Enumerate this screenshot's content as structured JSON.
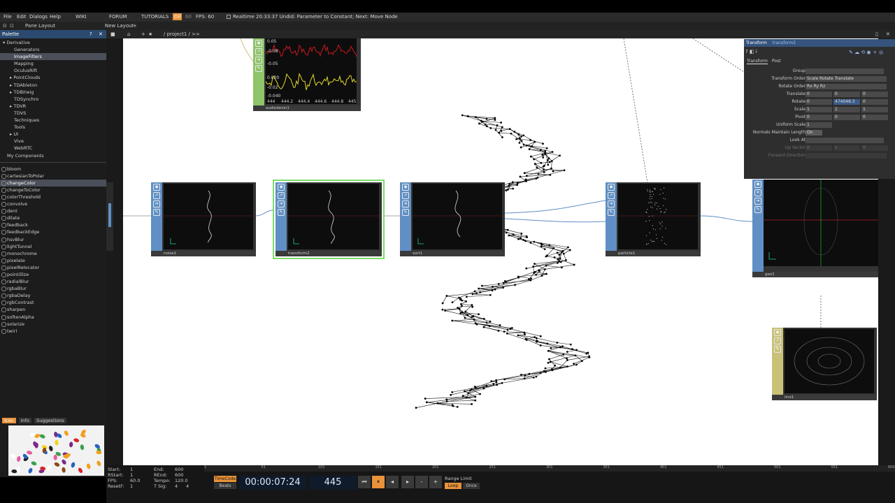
{
  "menubar": {
    "items": [
      "File",
      "Edit",
      "Dialogs",
      "Help",
      "WIKI",
      "FORUM",
      "TUTORIALS"
    ],
    "oil": "Oil",
    "fps_label": "60",
    "fps": "FPS:  60",
    "realtime": "Realtime",
    "status": "20:33:37 Undid: Parameter to Constant; Next: Move Node"
  },
  "toolbar": {
    "pane_layout": "Pane Layout",
    "new_layout": "New Layout"
  },
  "pathbar": {
    "path": "/ project1 / >>"
  },
  "palette": {
    "title": "Palette",
    "tree": [
      "Derivative",
      "Generators",
      "ImageFilters",
      "Mapping",
      "OculusRift",
      "PointClouds",
      "TDAbleton",
      "TDBitwig",
      "TDSynchro",
      "TDVR",
      "TDVS",
      "Techniques",
      "Tools",
      "UI",
      "Vive",
      "WebRTC",
      "My Components"
    ],
    "components": [
      "bloom",
      "cartesianToPolar",
      "changeColor",
      "changeToColor",
      "colorThreshold",
      "convolve",
      "dent",
      "dilate",
      "feedback",
      "feedbackEdge",
      "hsvBlur",
      "lightTunnel",
      "monochrome",
      "pixelate",
      "pixelRelocator",
      "pointillize",
      "radialBlur",
      "rgbaBlur",
      "rgbaDelay",
      "rgbContrast",
      "sharpen",
      "softenAlpha",
      "solarize",
      "twirl"
    ],
    "tabs": [
      "Icon",
      "Info",
      "Suggestions"
    ]
  },
  "nodes": {
    "audio": {
      "label": "audiodevin1",
      "vals": [
        "0.05",
        "-0.08",
        "-0.05",
        "0.020",
        "-0.02",
        "-0.040"
      ],
      "ticks": [
        "444",
        "444.2",
        "444.4",
        "444.6",
        "444.8",
        "445"
      ]
    },
    "n1": {
      "label": "noise1"
    },
    "n2": {
      "label": "transform2"
    },
    "n3": {
      "label": "sort1"
    },
    "n4": {
      "label": "particle1"
    },
    "n5": {
      "label": "geo1"
    },
    "n6": {
      "label": "line1"
    }
  },
  "params": {
    "op_type": "Transform",
    "op_name": "transform2",
    "tabs": [
      "Transform",
      "Post"
    ],
    "rows": [
      {
        "k": "Group",
        "v": ""
      },
      {
        "k": "Transform Order",
        "v": "Scale Rotate Translate"
      },
      {
        "k": "Rotate Order",
        "v": "Rx Ry Rz"
      },
      {
        "k": "Translate",
        "v": "0",
        "v2": "0",
        "v3": "0"
      },
      {
        "k": "Rotate",
        "v": "0",
        "v2": "474048.3",
        "v3": "0"
      },
      {
        "k": "Scale",
        "v": "1",
        "v2": "1",
        "v3": "1"
      },
      {
        "k": "Pivot",
        "v": "0",
        "v2": "0",
        "v3": "0"
      },
      {
        "k": "Uniform Scale",
        "v": "1"
      },
      {
        "k": "Normals Maintain Length",
        "v": "On"
      },
      {
        "k": "Look At",
        "v": ""
      },
      {
        "k": "Up Vector",
        "v": "0",
        "v2": "1",
        "v3": "0"
      },
      {
        "k": "Forward Direction",
        "v": ""
      }
    ]
  },
  "bottom": {
    "start_k": "Start:",
    "start_v": "1",
    "rstart_k": "RStart:",
    "rstart_v": "1",
    "fps_k": "FPS:",
    "fps_v": "60.0",
    "resetf_k": "ResetF:",
    "resetf_v": "1",
    "end_k": "End:",
    "end_v": "600",
    "rend_k": "REnd:",
    "rend_v": "600",
    "tempo_k": "Tempo:",
    "tempo_v": "120.0",
    "tsig_k": "T Sig:",
    "tsig_v1": "4",
    "tsig_v2": "4",
    "timecode_btn": "TimeCode",
    "beats_btn": "Beats",
    "timecode": "00:00:07:24",
    "frame": "445",
    "range_limit": "Range Limit",
    "loop": "Loop",
    "once": "Once",
    "ticks": [
      "1",
      "51",
      "101",
      "151",
      "201",
      "251",
      "301",
      "351",
      "401",
      "451",
      "501",
      "551",
      "600"
    ]
  },
  "colors": {
    "accent": "#e8923a",
    "node_side": "#5f8fc4",
    "selected_frame": "#7ddc6a",
    "audio_red": "#c8191e",
    "audio_yellow": "#e2d92a",
    "sop_side": "#c9c178"
  }
}
